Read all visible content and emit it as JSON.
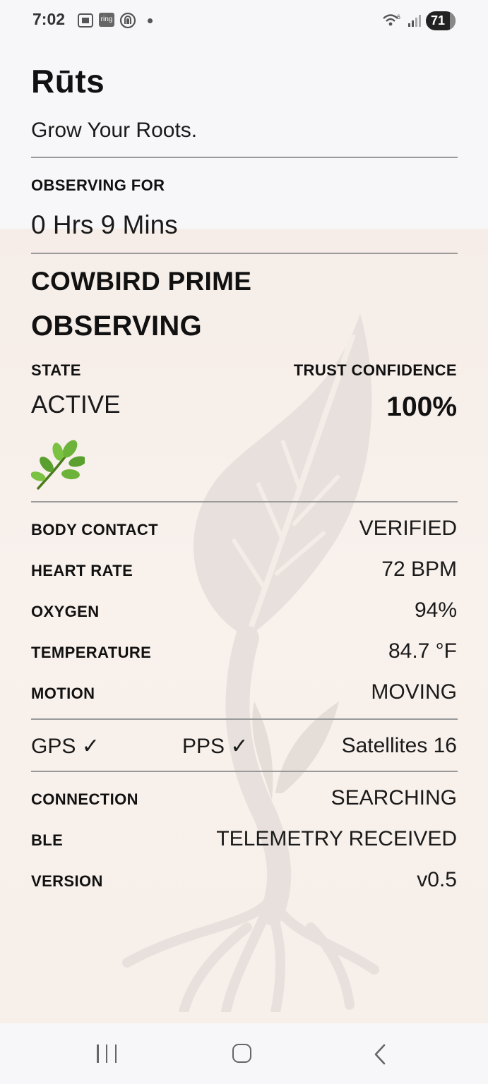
{
  "status_bar": {
    "time": "7:02",
    "ring_label": "ring",
    "network": "6",
    "battery": "71"
  },
  "app": {
    "title": "Rūts",
    "tagline": "Grow Your Roots."
  },
  "observing": {
    "label": "OBSERVING FOR",
    "duration": "0 Hrs 9 Mins"
  },
  "device": {
    "name": "COWBIRD PRIME",
    "mode": "OBSERVING"
  },
  "state": {
    "label": "STATE",
    "value": "ACTIVE",
    "emoji": "🌿"
  },
  "trust": {
    "label": "TRUST CONFIDENCE",
    "value": "100%"
  },
  "vitals": [
    {
      "label": "BODY CONTACT",
      "value": "VERIFIED"
    },
    {
      "label": "HEART RATE",
      "value": "72 BPM"
    },
    {
      "label": "OXYGEN",
      "value": "94%"
    },
    {
      "label": "TEMPERATURE",
      "value": "84.7 °F"
    },
    {
      "label": "MOTION",
      "value": "MOVING"
    }
  ],
  "gnss": {
    "gps": "GPS ✓",
    "pps": "PPS ✓",
    "satellites": "Satellites 16"
  },
  "system": [
    {
      "label": "CONNECTION",
      "value": "SEARCHING"
    },
    {
      "label": "BLE",
      "value": "TELEMETRY RECEIVED"
    },
    {
      "label": "VERSION",
      "value": "v0.5"
    }
  ],
  "colors": {
    "background_top": "#f7f7f9",
    "background_main": "#f6ede8",
    "divider": "#9a9a9a",
    "text": "#111111"
  },
  "icons": [
    "screenshot-icon",
    "ring-icon",
    "nfc-icon",
    "wifi-icon",
    "signal-icon",
    "battery-icon",
    "leaf-tree-watermark",
    "recents-icon",
    "home-icon",
    "back-icon"
  ]
}
